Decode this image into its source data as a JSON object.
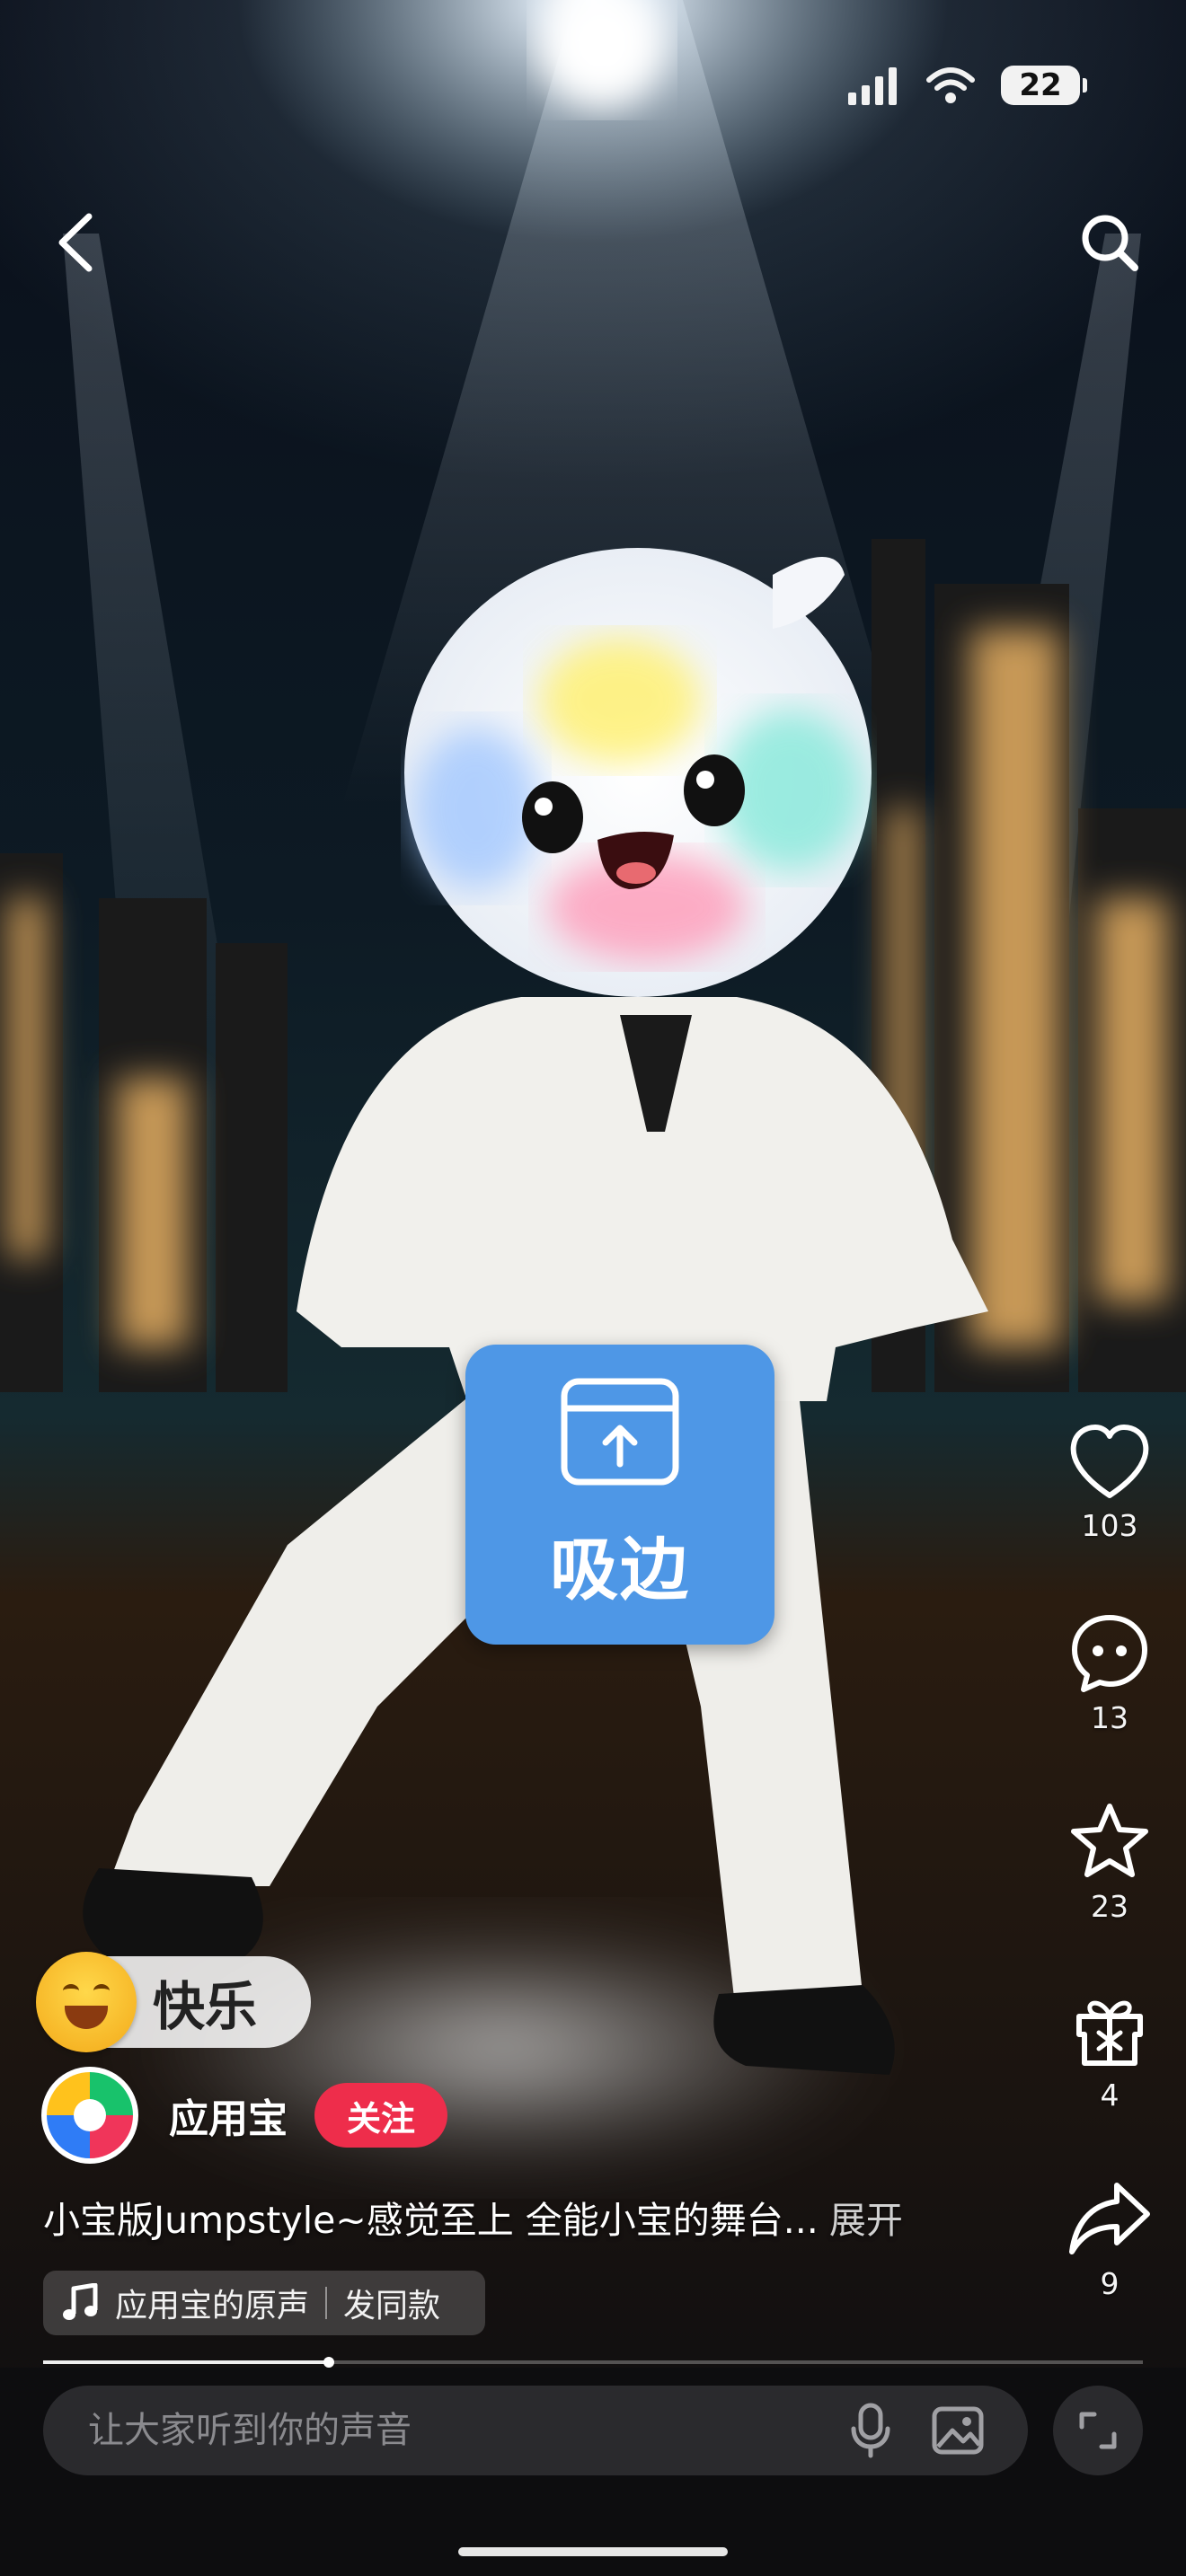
{
  "status_bar": {
    "battery": "22",
    "icons": [
      "cellular-signal-icon",
      "wifi-icon",
      "battery-icon"
    ]
  },
  "header": {
    "back_icon": "chevron-left-icon",
    "search_icon": "search-icon"
  },
  "float_widget": {
    "label": "吸边",
    "icon": "upload-window-icon"
  },
  "actions": [
    {
      "name": "like",
      "icon": "heart-icon",
      "count": "103"
    },
    {
      "name": "comment",
      "icon": "comment-bubble-icon",
      "count": "13"
    },
    {
      "name": "favorite",
      "icon": "star-icon",
      "count": "23"
    },
    {
      "name": "gift",
      "icon": "gift-icon",
      "count": "4"
    },
    {
      "name": "share",
      "icon": "share-arrow-icon",
      "count": "9"
    }
  ],
  "mood_tag": {
    "text": "快乐",
    "emoji": "smiling-face-icon"
  },
  "author": {
    "name": "应用宝",
    "follow_label": "关注"
  },
  "caption": {
    "text": "小宝版Jumpstyle~感觉至上 全能小宝的舞台...",
    "expand_label": "展开"
  },
  "music": {
    "title": "应用宝的原声",
    "action_label": "发同款",
    "icon": "music-note-icon"
  },
  "playback": {
    "progress": 0.26
  },
  "comment_box": {
    "placeholder": "让大家听到你的声音",
    "icons": [
      "microphone-icon",
      "image-icon"
    ]
  },
  "expand_icon": "fullscreen-expand-icon",
  "colors": {
    "follow": "#ee2d4b",
    "widget": "#4e97e6",
    "bar": "#0d0d0f"
  }
}
